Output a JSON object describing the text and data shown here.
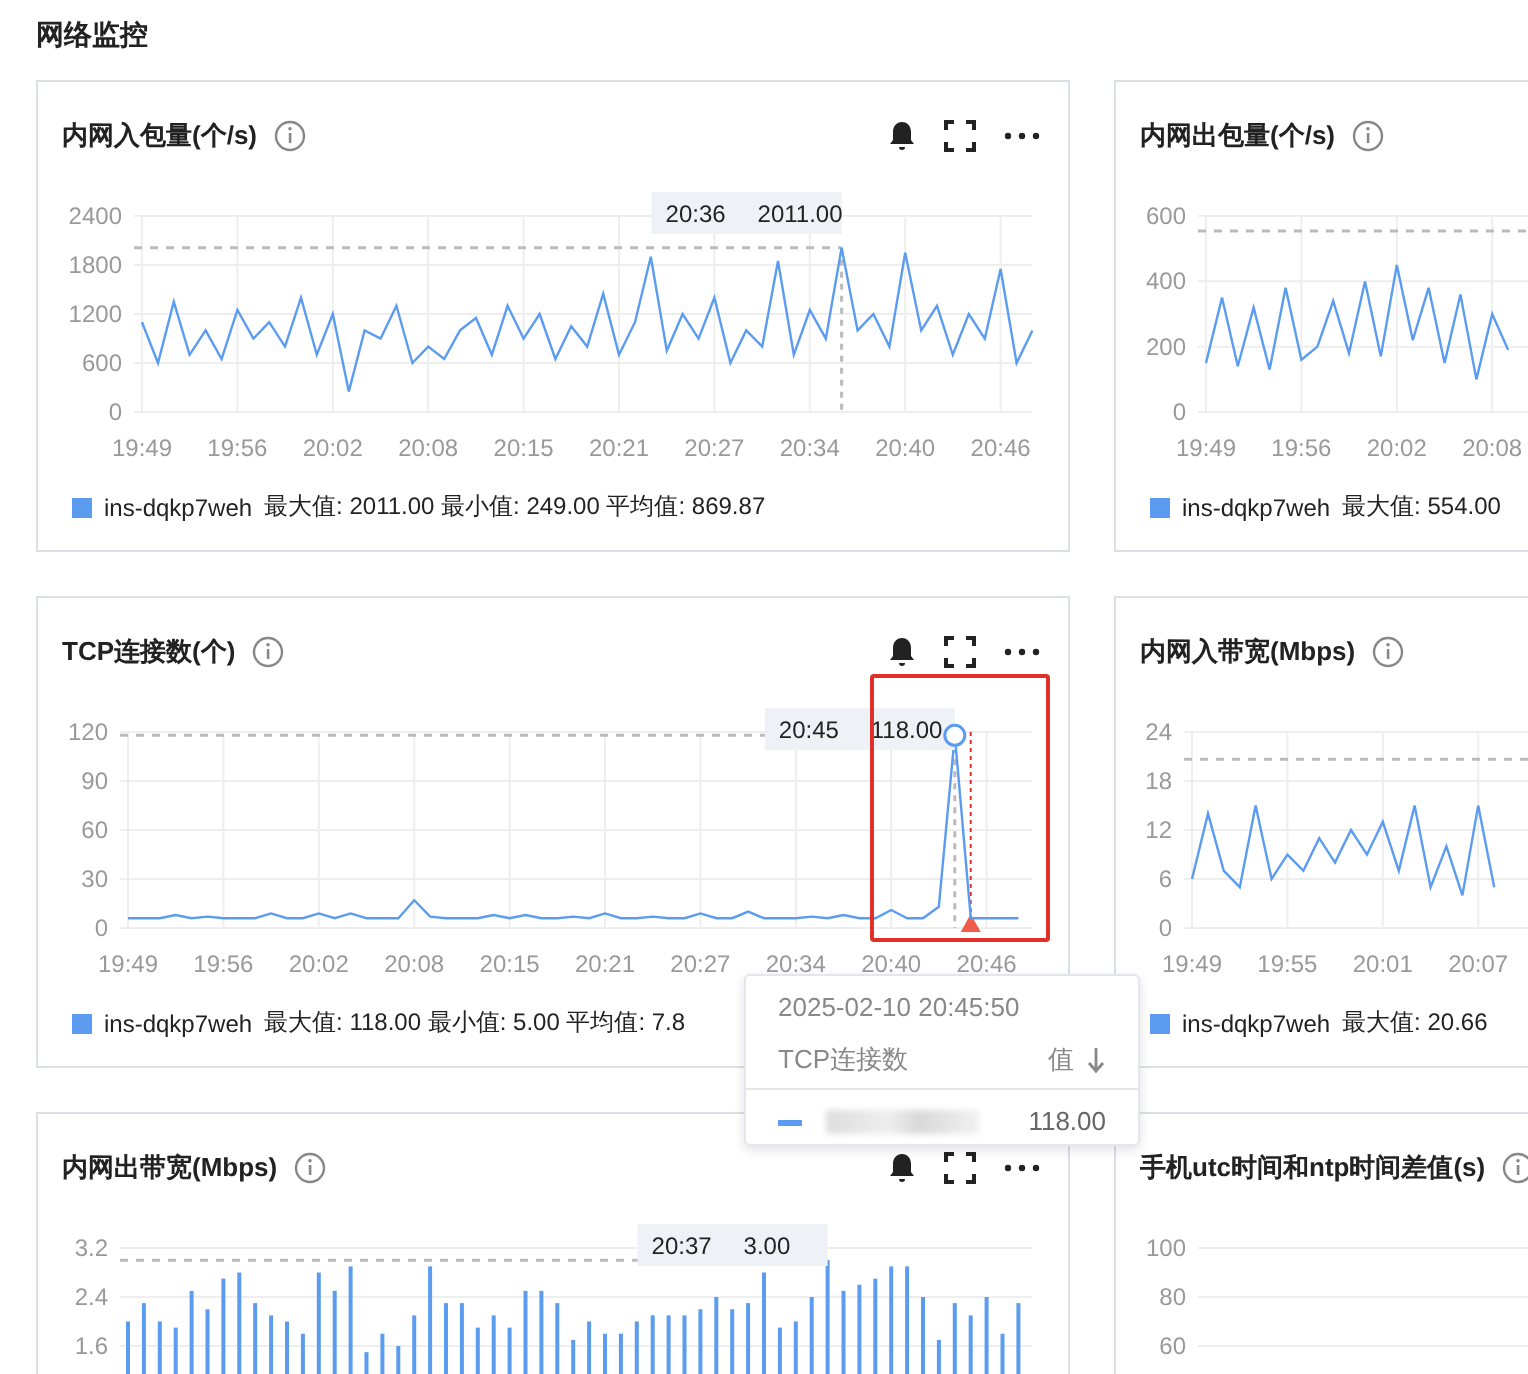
{
  "page_title": "网络监控",
  "cards": [
    {
      "title": "内网入包量(个/s)",
      "actions": true,
      "hover": {
        "time": "20:36",
        "value": "2011.00"
      },
      "chart_data": {
        "type": "line",
        "grid": true,
        "yticks": [
          0,
          600,
          1200,
          1800,
          2400
        ],
        "ylim": [
          0,
          2400
        ],
        "categories": [
          "19:49",
          null,
          null,
          null,
          null,
          null,
          "19:56",
          null,
          null,
          null,
          null,
          null,
          "20:02",
          null,
          null,
          null,
          null,
          null,
          "20:08",
          null,
          null,
          null,
          null,
          null,
          "20:15",
          null,
          null,
          null,
          null,
          null,
          "20:21",
          null,
          null,
          null,
          null,
          null,
          "20:27",
          null,
          null,
          null,
          null,
          null,
          "20:34",
          null,
          null,
          null,
          null,
          null,
          "20:40",
          null,
          null,
          null,
          null,
          null,
          "20:46",
          null,
          null
        ],
        "series": [
          {
            "name": "ins-dqkp7weh",
            "color": "#5b9cf0",
            "values": [
              1100,
              600,
              1350,
              700,
              1000,
              650,
              1250,
              900,
              1100,
              800,
              1400,
              700,
              1200,
              250,
              1000,
              900,
              1300,
              600,
              800,
              650,
              1000,
              1150,
              700,
              1300,
              900,
              1200,
              650,
              1050,
              800,
              1450,
              700,
              1100,
              1900,
              750,
              1200,
              900,
              1400,
              600,
              1000,
              800,
              1850,
              700,
              1250,
              900,
              2011,
              1000,
              1200,
              800,
              1950,
              1000,
              1300,
              700,
              1200,
              900,
              1750,
              600,
              1000
            ]
          }
        ],
        "ref_lines": [
          {
            "axis": "y",
            "value": 2011
          }
        ]
      },
      "legend": {
        "stats": "最大值: 2011.00 最小值: 249.00 平均值: 869.87"
      }
    },
    {
      "title": "内网出包量(个/s)",
      "chart_data": {
        "type": "line",
        "grid": true,
        "yticks": [
          0,
          200,
          400,
          600
        ],
        "ylim": [
          0,
          600
        ],
        "categories": [
          "19:49",
          null,
          null,
          null,
          null,
          null,
          "19:56",
          null,
          null,
          null,
          null,
          null,
          "20:02",
          null,
          null,
          null,
          null,
          null,
          "20:08",
          null
        ],
        "series": [
          {
            "name": "ins-dqkp7weh",
            "color": "#5b9cf0",
            "values": [
              150,
              350,
              140,
              320,
              130,
              380,
              160,
              200,
              340,
              180,
              400,
              170,
              450,
              220,
              380,
              150,
              360,
              100,
              300,
              190
            ]
          }
        ],
        "ref_lines": [
          {
            "axis": "y",
            "value": 554
          }
        ]
      },
      "legend": {
        "stats": "最大值: 554.00"
      }
    },
    {
      "title": "TCP连接数(个)",
      "actions": true,
      "highlight": true,
      "alarm": true,
      "hover": {
        "time": "20:45",
        "value": "118.00",
        "marker": true
      },
      "chart_data": {
        "type": "line",
        "grid": true,
        "yticks": [
          0,
          30,
          60,
          90,
          120
        ],
        "ylim": [
          0,
          120
        ],
        "categories": [
          "19:49",
          null,
          null,
          null,
          null,
          null,
          "19:56",
          null,
          null,
          null,
          null,
          null,
          "20:02",
          null,
          null,
          null,
          null,
          null,
          "20:08",
          null,
          null,
          null,
          null,
          null,
          "20:15",
          null,
          null,
          null,
          null,
          null,
          "20:21",
          null,
          null,
          null,
          null,
          null,
          "20:27",
          null,
          null,
          null,
          null,
          null,
          "20:34",
          null,
          null,
          null,
          null,
          null,
          "20:40",
          null,
          null,
          null,
          null,
          null,
          "20:46",
          null,
          null
        ],
        "series": [
          {
            "name": "ins-dqkp7weh",
            "color": "#5b9cf0",
            "values": [
              6,
              6,
              6,
              8,
              6,
              7,
              6,
              6,
              6,
              9,
              6,
              6,
              9,
              6,
              9,
              6,
              6,
              6,
              17,
              7,
              6,
              6,
              6,
              8,
              6,
              8,
              6,
              6,
              7,
              6,
              9,
              6,
              6,
              7,
              6,
              6,
              9,
              6,
              6,
              10,
              6,
              6,
              6,
              7,
              6,
              8,
              6,
              6,
              11,
              6,
              6,
              13,
              118,
              6,
              6,
              6,
              6
            ]
          }
        ],
        "ref_lines": [
          {
            "axis": "y",
            "value": 118
          }
        ]
      },
      "legend": {
        "stats": "最大值: 118.00 最小值: 5.00 平均值: 7.8"
      }
    },
    {
      "title": "内网入带宽(Mbps)",
      "chart_data": {
        "type": "line",
        "grid": true,
        "yticks": [
          0,
          6,
          12,
          18,
          24
        ],
        "ylim": [
          0,
          24
        ],
        "categories": [
          "19:49",
          null,
          null,
          null,
          null,
          null,
          "19:55",
          null,
          null,
          null,
          null,
          null,
          "20:01",
          null,
          null,
          null,
          null,
          null,
          "20:07",
          null
        ],
        "series": [
          {
            "name": "ins-dqkp7weh",
            "color": "#5b9cf0",
            "values": [
              6,
              14,
              7,
              5,
              15,
              6,
              9,
              7,
              11,
              8,
              12,
              9,
              13,
              7,
              15,
              5,
              10,
              4,
              15,
              5
            ]
          }
        ],
        "ref_lines": [
          {
            "axis": "y",
            "value": 20.66
          }
        ]
      },
      "legend": {
        "stats": "最大值: 20.66"
      }
    },
    {
      "title": "内网出带宽(Mbps)",
      "actions": true,
      "hover": {
        "time": "20:37",
        "value": "3.00"
      },
      "chart_data": {
        "type": "bar",
        "grid": true,
        "yticks": [
          1.6,
          2.4,
          3.2
        ],
        "ylim": [
          0,
          3.2
        ],
        "categories": [
          null,
          null,
          null,
          null,
          null,
          null,
          null,
          null,
          null,
          null,
          null,
          null,
          null,
          null,
          null,
          null,
          null,
          null,
          null,
          null,
          null,
          null,
          null,
          null,
          null,
          null,
          null,
          null,
          null,
          null,
          null,
          null,
          null,
          null,
          null,
          null,
          null,
          null,
          null,
          null,
          null,
          null,
          null,
          null,
          null,
          null,
          null,
          null,
          null,
          null,
          null,
          null,
          null,
          null,
          null,
          null,
          null
        ],
        "series": [
          {
            "color": "#5b9cf0",
            "values": [
              2.0,
              2.3,
              2.0,
              1.9,
              2.5,
              2.2,
              2.7,
              2.8,
              2.3,
              2.1,
              2.0,
              1.8,
              2.8,
              2.5,
              2.9,
              1.5,
              1.8,
              1.6,
              2.1,
              2.9,
              2.3,
              2.3,
              1.9,
              2.1,
              1.9,
              2.5,
              2.5,
              2.3,
              1.7,
              2.0,
              1.8,
              1.8,
              2.0,
              2.1,
              2.1,
              2.1,
              2.2,
              2.4,
              2.2,
              2.3,
              2.8,
              1.9,
              2.0,
              2.4,
              3.0,
              2.5,
              2.6,
              2.7,
              2.9,
              2.9,
              2.4,
              1.7,
              2.3,
              2.1,
              2.4,
              1.8,
              2.3
            ]
          }
        ],
        "ref_lines": [
          {
            "axis": "y",
            "value": 3.0
          }
        ]
      }
    },
    {
      "title": "手机utc时间和ntp时间差值(s)",
      "axis_labels": [
        "100",
        "80",
        "60"
      ]
    }
  ],
  "tooltip": {
    "datetime": "2025-02-10 20:45:50",
    "series_header": "TCP连接数",
    "value_header": "值",
    "rows": [
      {
        "value": "118.00",
        "color": "#5b9cf0"
      }
    ]
  }
}
